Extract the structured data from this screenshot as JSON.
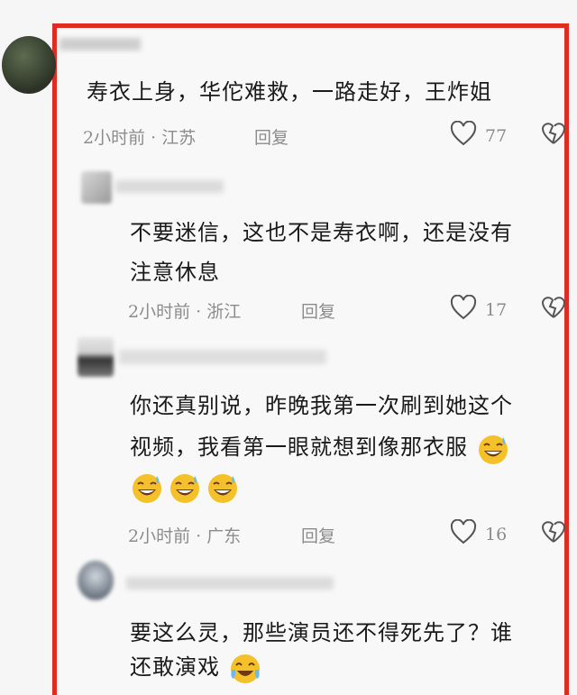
{
  "comments": [
    {
      "text": "寿衣上身，华佗难救，一路走好，王炸姐",
      "time": "2小时前",
      "location": "江苏",
      "reply": "回复",
      "likes": "77"
    },
    {
      "text_line1": "不要迷信，这也不是寿衣啊，还是没有",
      "text_line2": "注意休息",
      "time": "2小时前",
      "location": "浙江",
      "reply": "回复",
      "likes": "17"
    },
    {
      "text_line1": "你还真别说，昨晚我第一次刷到她这个",
      "text_line2": "视频，我看第一眼就想到像那衣服",
      "time": "2小时前",
      "location": "广东",
      "reply": "回复",
      "likes": "16"
    },
    {
      "text_line1": "要这么灵，那些演员还不得死先了？谁",
      "text_line2": "还敢演戏"
    }
  ],
  "separator": "·",
  "colors": {
    "frame": "#e02b20",
    "meta": "#8c8c8c"
  }
}
